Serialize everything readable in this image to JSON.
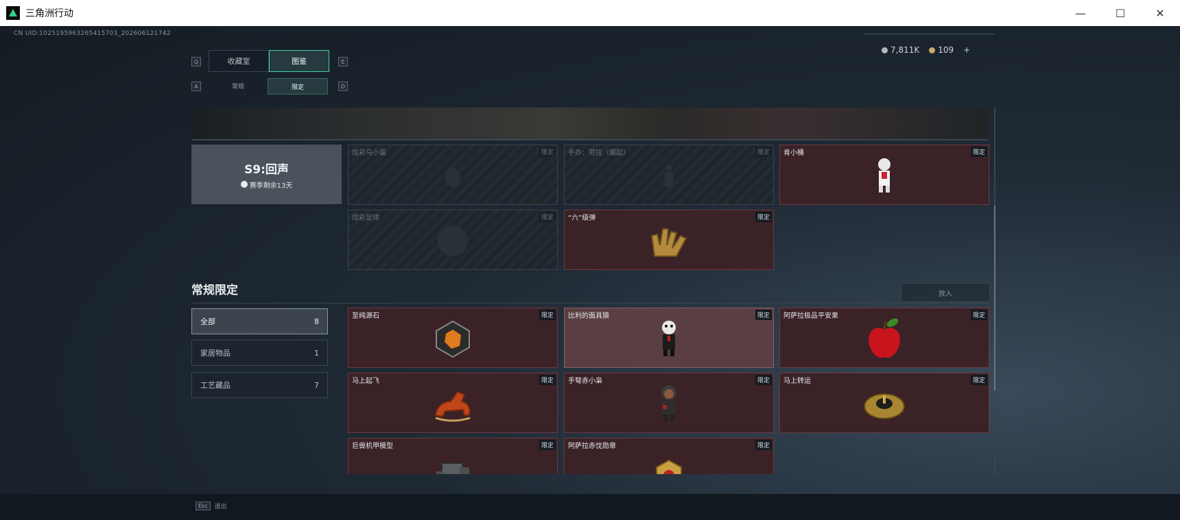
{
  "window": {
    "title": "三角洲行动",
    "controls": {
      "minimize": "—",
      "maximize": "☐",
      "close": "✕"
    }
  },
  "uid": "CN UID:10251959632654157​03_202606121742",
  "currency": {
    "silver": "7,811K",
    "gold": "109",
    "add": "+"
  },
  "tabs": {
    "hint_left": "Q",
    "hint_right": "E",
    "items": [
      {
        "label": "收藏室"
      },
      {
        "label": "图鉴"
      }
    ]
  },
  "subtabs": {
    "hint_left": "A",
    "hint_right": "D",
    "items": [
      {
        "label": "常规"
      },
      {
        "label": "限定"
      }
    ]
  },
  "season": {
    "title": "S9:回声",
    "remain": "赛季剩余13天"
  },
  "tag_label": "限定",
  "season_cards": [
    {
      "name": "炫彩乌小蛋"
    },
    {
      "name": "手办：劳拉（崛起）"
    },
    {
      "name": "肯小桶"
    },
    {
      "name": "炫彩足球"
    },
    {
      "name": "“六”级弹"
    }
  ],
  "section": {
    "title": "常规限定",
    "put_in": "放入"
  },
  "filters": [
    {
      "label": "全部",
      "count": "8"
    },
    {
      "label": "家居物品",
      "count": "1"
    },
    {
      "label": "工艺藏品",
      "count": "7"
    }
  ],
  "cards": [
    {
      "name": "至纯源石"
    },
    {
      "name": "比利的面具猿"
    },
    {
      "name": "阿萨拉极品平安果"
    },
    {
      "name": "马上起飞"
    },
    {
      "name": "手弩赤小枭"
    },
    {
      "name": "马上转运"
    },
    {
      "name": "巨兽机甲模型"
    },
    {
      "name": "阿萨拉赤忱勋章"
    }
  ],
  "bottom": {
    "key": "Esc",
    "label": "退出"
  }
}
